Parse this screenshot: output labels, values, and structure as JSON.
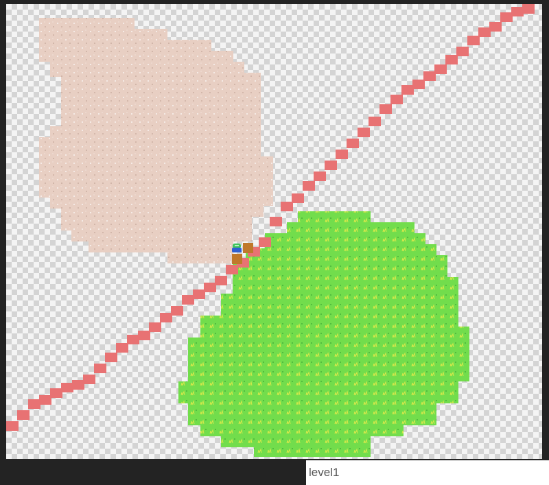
{
  "level_input": {
    "value": "level1"
  },
  "colors": {
    "sand": "#e8cfc3",
    "grass": "#72dd4c",
    "road": "#e87273",
    "dirt": "#c0782b",
    "player_green": "#3fc45c",
    "player_blue": "#2e5fd2"
  },
  "map": {
    "regions": [
      {
        "name": "sand-region",
        "type": "sand"
      },
      {
        "name": "grass-region",
        "type": "grass"
      },
      {
        "name": "road-path",
        "type": "road"
      }
    ],
    "entities": [
      {
        "name": "player",
        "sprite": "player-sprite"
      },
      {
        "name": "dirt-tiles",
        "sprite": "dirt-tile"
      }
    ]
  }
}
